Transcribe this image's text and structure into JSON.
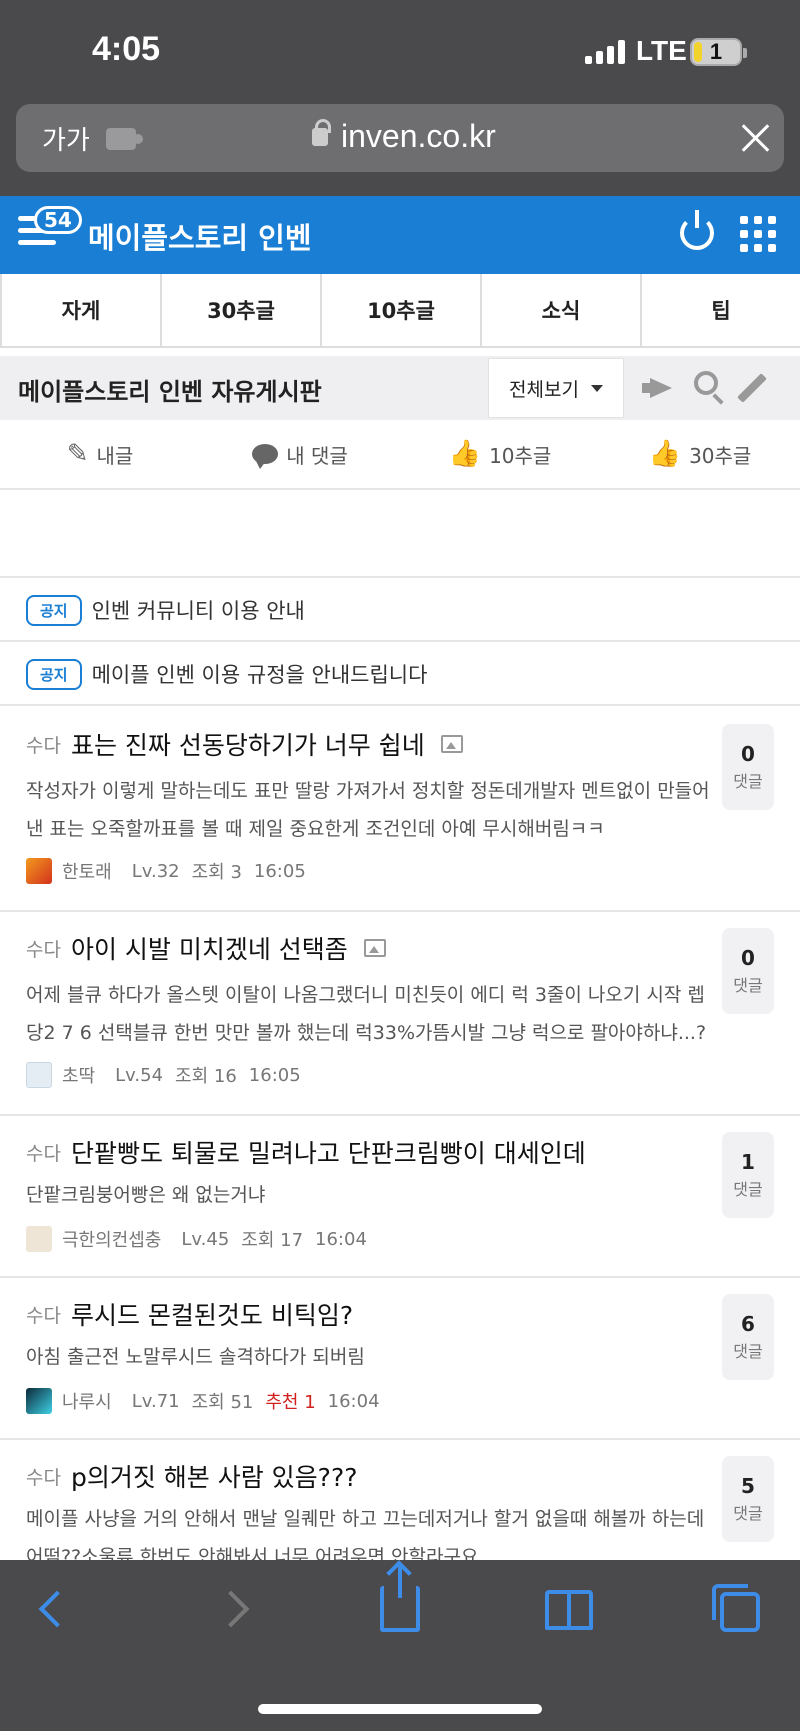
{
  "status": {
    "time": "4:05",
    "network": "LTE",
    "battery": "1"
  },
  "browser": {
    "text_size": "가가",
    "url": "inven.co.kr"
  },
  "header": {
    "notification_count": "54",
    "title": "메이플스토리 인벤"
  },
  "category_tabs": [
    "자게",
    "30추글",
    "10추글",
    "소식",
    "팁"
  ],
  "board": {
    "title": "메이플스토리 인벤 자유게시판",
    "filter": "전체보기"
  },
  "my_bar": [
    {
      "label": "내글",
      "icon": "my-pencil-icon"
    },
    {
      "label": "내 댓글",
      "icon": "comment-bubble-icon"
    },
    {
      "label": "10추글",
      "icon": "thumbs-up-icon"
    },
    {
      "label": "30추글",
      "icon": "thumbs-up-icon"
    }
  ],
  "notices": [
    {
      "badge": "공지",
      "text": "인벤 커뮤니티 이용 안내"
    },
    {
      "badge": "공지",
      "text": "메이플 인벤 이용 규정을 안내드립니다"
    }
  ],
  "posts": [
    {
      "category": "수다",
      "title": "표는 진짜 선동당하기가 너무 쉽네",
      "has_image": true,
      "preview": "작성자가 이렇게 말하는데도 표만 딸랑 가져가서 정치할 정돈데개발자 멘트없이 만들어낸 표는 오죽할까표를 볼 때 제일 중요한게 조건인데 아예 무시해버림ㅋㅋ",
      "nick": "한토래",
      "level": "Lv.32",
      "views": "조회 3",
      "recommend": "",
      "time": "16:05",
      "comments": "0",
      "comment_label": "댓글"
    },
    {
      "category": "수다",
      "title": "아이 시발 미치겠네 선택좀",
      "has_image": true,
      "preview": "어제 블큐 하다가 올스텟 이탈이 나옴그랬더니 미친듯이 에디 럭 3줄이 나오기 시작 렙당2 7 6 선택블큐 한번 맛만 볼까 했는데 럭33%가뜸시발 그냥 럭으로 팔아야하냐...?",
      "nick": "초딱",
      "level": "Lv.54",
      "views": "조회 16",
      "recommend": "",
      "time": "16:05",
      "comments": "0",
      "comment_label": "댓글"
    },
    {
      "category": "수다",
      "title": "단팥빵도 퇴물로 밀려나고 단판크림빵이 대세인데",
      "has_image": false,
      "preview": "단팥크림붕어빵은 왜 없는거냐",
      "nick": "극한의컨셉충",
      "level": "Lv.45",
      "views": "조회 17",
      "recommend": "",
      "time": "16:04",
      "comments": "1",
      "comment_label": "댓글"
    },
    {
      "category": "수다",
      "title": "루시드 몬컬된것도 비틱임?",
      "has_image": false,
      "preview": "아침 출근전 노말루시드 솔격하다가 되버림",
      "nick": "나루시",
      "level": "Lv.71",
      "views": "조회 51",
      "recommend": "추천 1",
      "time": "16:04",
      "comments": "6",
      "comment_label": "댓글"
    },
    {
      "category": "수다",
      "title": "p의거짓 해본 사람 있음???",
      "has_image": false,
      "preview": "메이플 사냥을 거의 안해서 맨날 일퀘만 하고 끄는데저거나 할거 없을때 해볼까 하는데 어떰??소울류 한번도 안해봐서 너무 어려우면 안할라구요",
      "nick": "",
      "level": "",
      "views": "",
      "recommend": "",
      "time": "",
      "comments": "5",
      "comment_label": "댓글"
    }
  ],
  "colors": {
    "brand": "#1a7fd4",
    "recommend": "#d0211f",
    "ios_tint": "#3c8ce8"
  }
}
